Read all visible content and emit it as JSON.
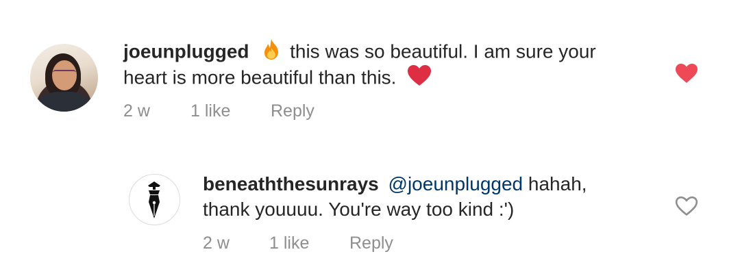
{
  "comment": {
    "username": "joeunplugged",
    "text_line1": "this was so beautiful. I am sure your",
    "text_line2": "heart is more beautiful than this.",
    "emoji_before": "fire-emoji",
    "emoji_after": "red-heart-emoji",
    "time": "2 w",
    "likes": "1 like",
    "reply_label": "Reply",
    "liked": true,
    "like_icon": "heart-filled-icon",
    "like_color": "#ed4956"
  },
  "reply": {
    "username": "beneaththesunrays",
    "mention": "@joeunplugged",
    "text_line1": "hahah,",
    "text_line2": "thank youuuu. You're way too kind :')",
    "time": "2 w",
    "likes": "1 like",
    "reply_label": "Reply",
    "liked": false,
    "like_icon": "heart-outline-icon",
    "avatar_icon": "fountain-pen-logo"
  }
}
